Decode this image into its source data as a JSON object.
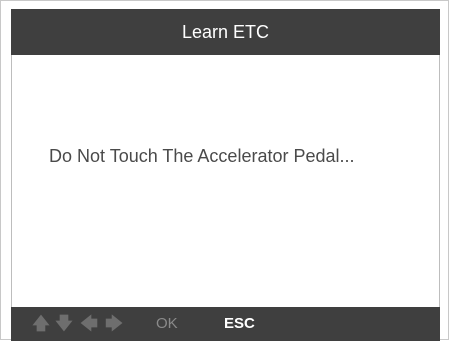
{
  "header": {
    "title": "Learn ETC"
  },
  "content": {
    "message": "Do Not Touch The Accelerator Pedal..."
  },
  "footer": {
    "arrow_up_glyph": "🡅",
    "arrow_down_glyph": "🡇",
    "arrow_left_glyph": "🡄",
    "arrow_right_glyph": "🡆",
    "ok_label": "OK",
    "esc_label": "ESC"
  },
  "colors": {
    "title_bar": "#3f3f3f",
    "footer_bar": "#3f3f3f",
    "text": "#4a4a4a",
    "disabled_key": "#8a8a8a",
    "active_key": "#ffffff"
  },
  "icons": {
    "up": "arrow-up-icon",
    "down": "arrow-down-icon",
    "left": "arrow-left-icon",
    "right": "arrow-right-icon"
  }
}
